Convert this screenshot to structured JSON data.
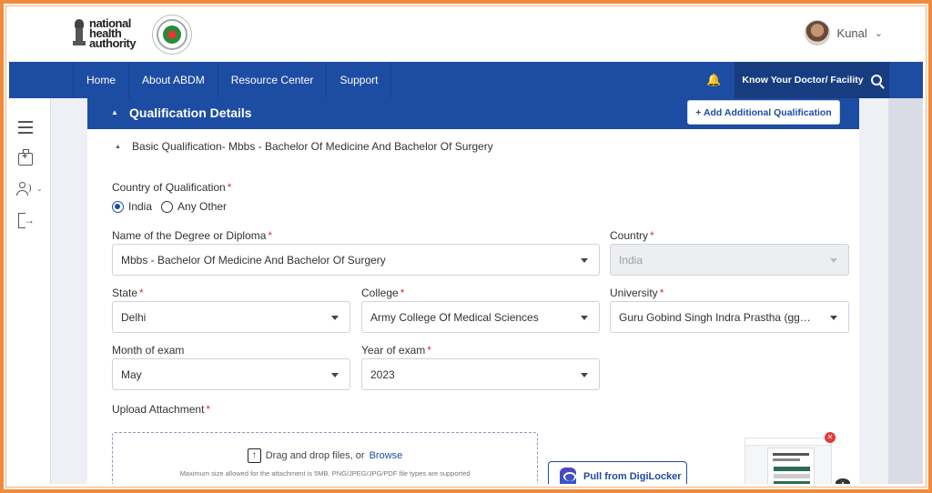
{
  "header": {
    "org_logo_text": "national health authority",
    "user": {
      "name": "Kunal"
    }
  },
  "nav": {
    "items": [
      "Home",
      "About ABDM",
      "Resource Center",
      "Support"
    ],
    "search_label": "Know Your Doctor/ Facility"
  },
  "sidebar": {
    "icons": [
      "menu-icon",
      "medical-kit-icon",
      "users-icon",
      "logout-icon"
    ]
  },
  "section": {
    "title": "Qualification Details",
    "add_button": "+ Add Additional Qualification",
    "subsection_title": "Basic Qualification- Mbbs - Bachelor Of Medicine And Bachelor Of Surgery"
  },
  "form": {
    "country_of_qualification": {
      "label": "Country of Qualification",
      "options": [
        "India",
        "Any Other"
      ],
      "selected": "India"
    },
    "degree": {
      "label": "Name of the Degree or Diploma",
      "value": "Mbbs - Bachelor Of Medicine And Bachelor Of Surgery"
    },
    "country": {
      "label": "Country",
      "value": "India"
    },
    "state": {
      "label": "State",
      "value": "Delhi"
    },
    "college": {
      "label": "College",
      "value": "Army College Of Medical Sciences"
    },
    "university": {
      "label": "University",
      "value": "Guru Gobind Singh Indra Prastha (ggsi..."
    },
    "month_of_exam": {
      "label": "Month of exam",
      "value": "May"
    },
    "year_of_exam": {
      "label": "Year of exam",
      "value": "2023"
    },
    "upload": {
      "label": "Upload Attachment",
      "drag_text": "Drag and drop files, or",
      "browse_text": "Browse",
      "hint": "Maximum size allowed for the attachment is 5MB. PNG/JPEG/JPG/PDF file types are supported",
      "digilocker_button": "Pull from DigiLocker"
    },
    "required_mark": "*"
  },
  "colors": {
    "primary": "#1d4ca3",
    "frame": "#f08a3c",
    "required": "#dd3333"
  }
}
